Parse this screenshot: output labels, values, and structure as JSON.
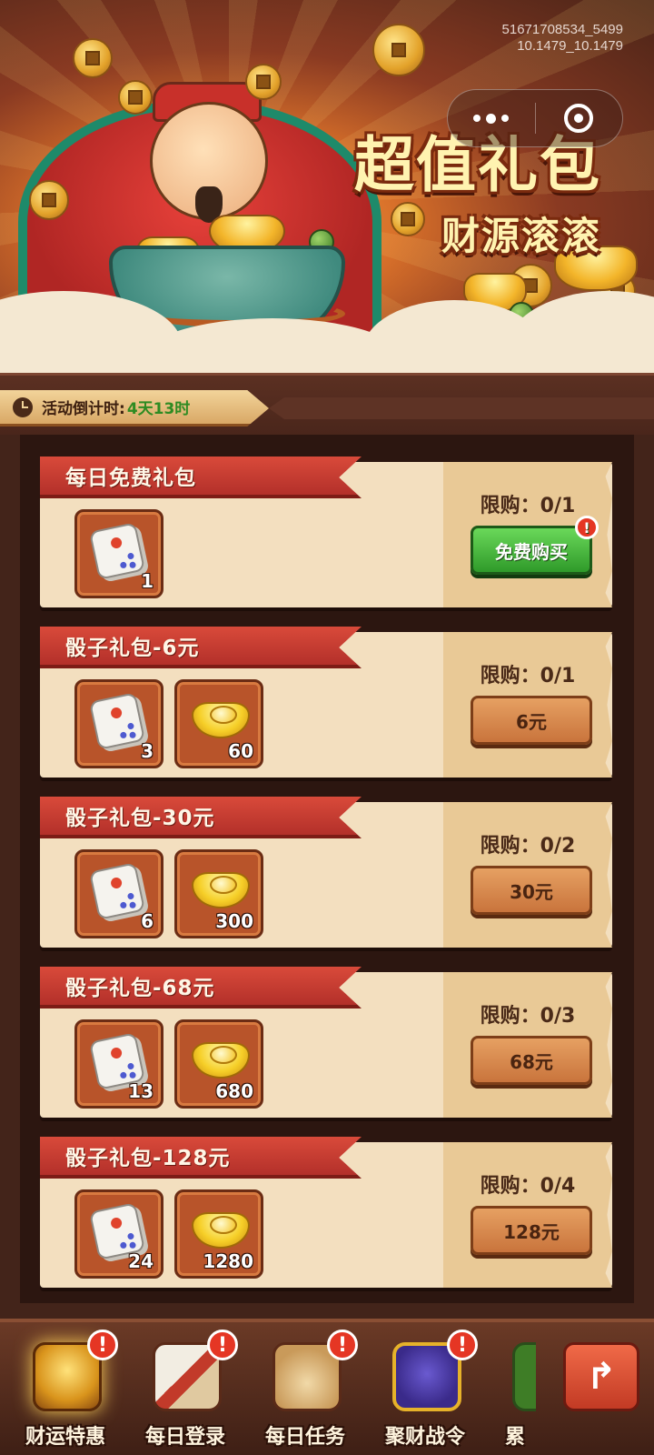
{
  "watermark": {
    "line1": "51671708534_5499",
    "line2": "10.1479_10.1479"
  },
  "banner": {
    "title": "超值礼包",
    "subtitle": "财源滚滚"
  },
  "capsule": {
    "more_icon": "more-dots-icon",
    "close_icon": "target-close-icon"
  },
  "countdown": {
    "label": "活动倒计时:",
    "value": "4天13时"
  },
  "packages": [
    {
      "name": "每日免费礼包",
      "limit": "限购：0/1",
      "button": "免费购买",
      "button_style": "free",
      "alert": "!",
      "items": [
        {
          "icon": "dice-icon",
          "count": "1"
        }
      ]
    },
    {
      "name": "骰子礼包-6元",
      "limit": "限购：0/1",
      "button": "6元",
      "items": [
        {
          "icon": "dice-icon",
          "count": "3"
        },
        {
          "icon": "gold-ingot-icon",
          "count": "60"
        }
      ]
    },
    {
      "name": "骰子礼包-30元",
      "limit": "限购：0/2",
      "button": "30元",
      "items": [
        {
          "icon": "dice-icon",
          "count": "6"
        },
        {
          "icon": "gold-ingot-icon",
          "count": "300"
        }
      ]
    },
    {
      "name": "骰子礼包-68元",
      "limit": "限购：0/3",
      "button": "68元",
      "items": [
        {
          "icon": "dice-icon",
          "count": "13"
        },
        {
          "icon": "gold-ingot-icon",
          "count": "680"
        }
      ]
    },
    {
      "name": "骰子礼包-128元",
      "limit": "限购：0/4",
      "button": "128元",
      "items": [
        {
          "icon": "dice-icon",
          "count": "24"
        },
        {
          "icon": "gold-ingot-icon",
          "count": "1280"
        }
      ]
    }
  ],
  "nav": {
    "items": [
      {
        "label": "财运特惠",
        "icon": "treasure-chest-icon",
        "alert": "!",
        "active": true
      },
      {
        "label": "每日登录",
        "icon": "scroll-flag-icon",
        "alert": "!"
      },
      {
        "label": "每日任务",
        "icon": "task-scroll-icon",
        "alert": "!"
      },
      {
        "label": "聚财战令",
        "icon": "gold-token-icon",
        "alert": "!"
      },
      {
        "label": "累",
        "icon": "partial-item-icon"
      }
    ],
    "exit_icon": "exit-arrow-icon",
    "exit_glyph": "↱"
  },
  "colors": {
    "ribbon": "#c8392e",
    "free_button": "#3fae35",
    "price_button": "#d98a4e",
    "countdown_value": "#2e8b22",
    "alert_badge": "#e53624"
  }
}
